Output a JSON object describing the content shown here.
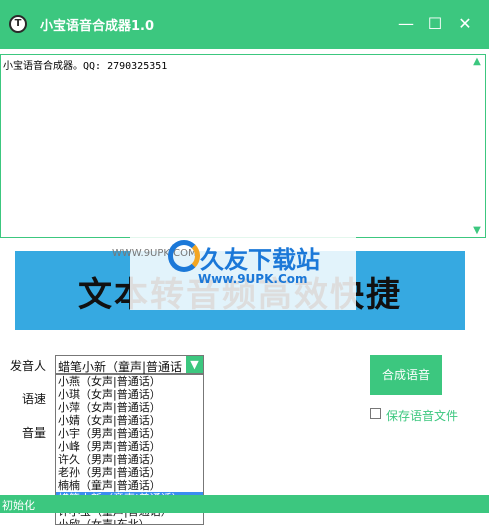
{
  "window": {
    "title": "小宝语音合成器1.0"
  },
  "window_controls": {
    "minimize": "—",
    "maximize": "☐",
    "close": "✕"
  },
  "textarea": {
    "content": "小宝语音合成器。QQ: 2790325351"
  },
  "banner": {
    "text": "文本转音频高效快捷"
  },
  "watermark": {
    "url_left": "WWW.9UPK.COM",
    "name": "久友下载站",
    "url": "Www.9UPK.Com"
  },
  "labels": {
    "voice": "发音人",
    "speed": "语速",
    "volume": "音量"
  },
  "voice_select": {
    "value": "蜡笔小新（童声|普通话"
  },
  "voice_options": [
    "小燕（女声|普通话）",
    "小琪（女声|普通话）",
    "小萍（女声|普通话）",
    "小婧（女声|普通话）",
    "小宇（男声|普通话）",
    "小峰（男声|普通话）",
    "许久（男声|普通话）",
    "老孙（男声|普通话）",
    "楠楠（童声|普通话）",
    "蜡笔小新（童声|普通话）",
    "许小宝（童声|普通话）",
    "小欣（女声|东北）"
  ],
  "selected_index": 9,
  "synth_button": "合成语音",
  "save_checkbox": {
    "label": "保存语音文件",
    "checked": false
  },
  "status": "初始化",
  "colors": {
    "accent": "#3cc77f",
    "banner": "#36a9e1",
    "selection": "#3b8df0"
  }
}
